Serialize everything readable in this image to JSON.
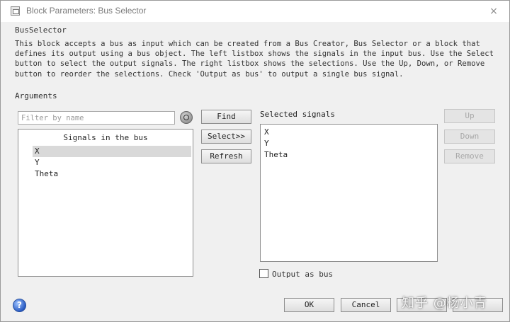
{
  "window": {
    "title": "Block Parameters: Bus Selector",
    "close_glyph": "×"
  },
  "block_type": "BusSelector",
  "description": "This block accepts a bus as input which can be created from a Bus Creator, Bus Selector or a block that\ndefines its output using a bus object. The left listbox shows the signals in the input bus. Use the Select\nbutton to select the output signals. The right listbox shows the selections. Use the Up, Down, or Remove\nbutton to reorder the selections. Check 'Output as bus' to output a single bus signal.",
  "arguments_label": "Arguments",
  "filter": {
    "placeholder": "Filter by name",
    "value": "",
    "options_icon": "filter-options-icon"
  },
  "bus_signals": {
    "header": "Signals in the bus",
    "items": [
      {
        "label": "X",
        "selected": true
      },
      {
        "label": "Y",
        "selected": false
      },
      {
        "label": "Theta",
        "selected": false
      }
    ]
  },
  "middle_buttons": {
    "find": "Find",
    "select": "Select>>",
    "refresh": "Refresh"
  },
  "selected_signals": {
    "label": "Selected signals",
    "items": [
      "X",
      "Y",
      "Theta"
    ]
  },
  "order_buttons": {
    "up": "Up",
    "down": "Down",
    "remove": "Remove"
  },
  "output_as_bus": {
    "label": "Output as bus",
    "checked": false
  },
  "footer": {
    "help_icon": "help-icon",
    "ok": "OK",
    "cancel": "Cancel",
    "watermark": "知乎 @杨小青"
  },
  "colors": {
    "dialog_bg": "#f0f0f0",
    "selection_bg": "#d9d9d9",
    "disabled_text": "#a8a8a8"
  }
}
